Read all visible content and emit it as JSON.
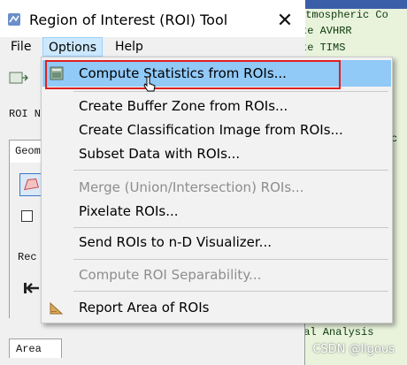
{
  "window": {
    "title": "Region of Interest (ROI) Tool",
    "close_glyph": "✕"
  },
  "menubar": {
    "items": [
      "File",
      "Options",
      "Help"
    ],
    "active": "Options"
  },
  "options_menu": {
    "items": [
      {
        "label": "Compute Statistics from ROIs...",
        "enabled": true,
        "highlighted": true,
        "icon": "statistics-icon"
      },
      {
        "label": "Create Buffer Zone from ROIs...",
        "enabled": true
      },
      {
        "label": "Create Classification Image from ROIs...",
        "enabled": true
      },
      {
        "label": "Subset Data with ROIs...",
        "enabled": true
      },
      {
        "label": "Merge (Union/Intersection) ROIs...",
        "enabled": false
      },
      {
        "label": "Pixelate ROIs...",
        "enabled": true
      },
      {
        "label": "Send ROIs to n-D Visualizer...",
        "enabled": true
      },
      {
        "label": "Compute ROI Separability...",
        "enabled": false
      },
      {
        "label": "Report Area of ROIs",
        "enabled": true,
        "icon": "ruler-triangle-icon"
      }
    ]
  },
  "left_panel": {
    "roi_label": "ROI N",
    "geom_tab": "Geom",
    "rec_label": "Rec",
    "area_tab": "Area"
  },
  "background_tree": {
    "items": [
      "Atmospheric Co",
      "te AVHRR",
      "te TIMS",
      "c",
      "",
      "",
      "",
      "",
      "",
      "",
      "",
      "",
      "",
      "",
      "",
      "",
      "",
      "",
      "",
      "",
      "",
      "ral Analysis"
    ]
  },
  "watermark": "CSDN @ligous",
  "colors": {
    "highlight": "#91c9f7",
    "menu_active": "#cce8ff",
    "red_frame": "#e02020",
    "tree_bg": "#e9f3dc"
  }
}
